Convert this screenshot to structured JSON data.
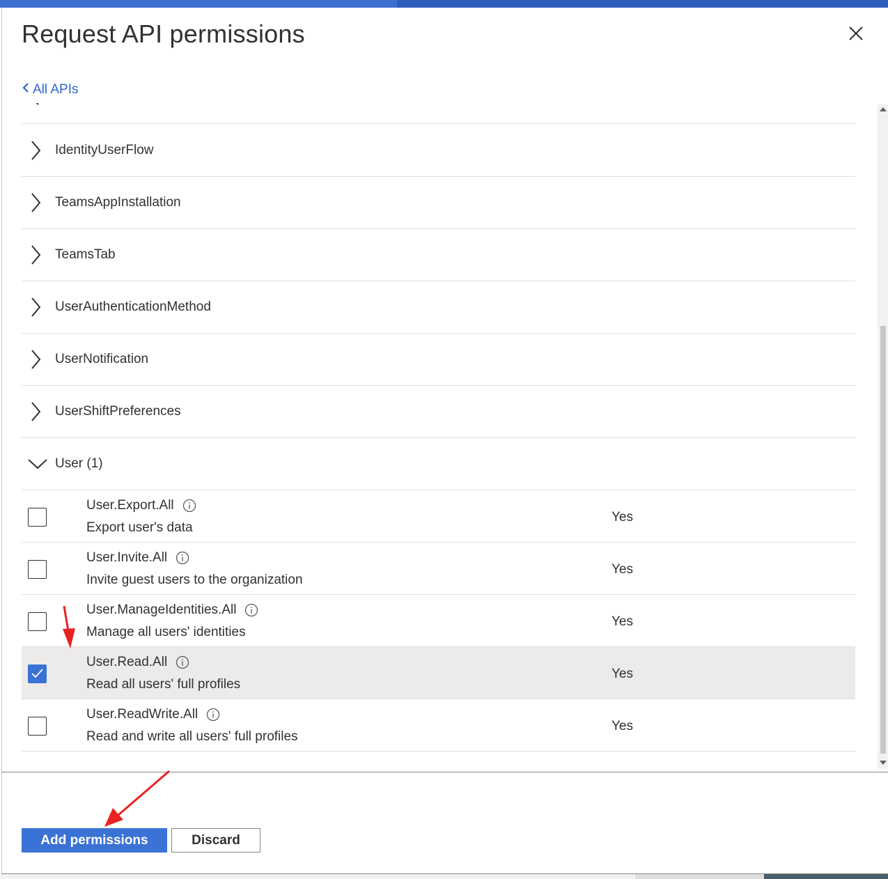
{
  "panel": {
    "title": "Request API permissions",
    "back_link": "All APIs"
  },
  "groups": [
    {
      "label": "IdentityUserFlow",
      "expanded": false
    },
    {
      "label": "TeamsAppInstallation",
      "expanded": false
    },
    {
      "label": "TeamsTab",
      "expanded": false
    },
    {
      "label": "UserAuthenticationMethod",
      "expanded": false
    },
    {
      "label": "UserNotification",
      "expanded": false
    },
    {
      "label": "UserShiftPreferences",
      "expanded": false
    },
    {
      "label": "User (1)",
      "expanded": true
    }
  ],
  "permissions": [
    {
      "name": "User.Export.All",
      "description": "Export user's data",
      "admin_consent": "Yes",
      "checked": false
    },
    {
      "name": "User.Invite.All",
      "description": "Invite guest users to the organization",
      "admin_consent": "Yes",
      "checked": false
    },
    {
      "name": "User.ManageIdentities.All",
      "description": "Manage all users' identities",
      "admin_consent": "Yes",
      "checked": false
    },
    {
      "name": "User.Read.All",
      "description": "Read all users' full profiles",
      "admin_consent": "Yes",
      "checked": true
    },
    {
      "name": "User.ReadWrite.All",
      "description": "Read and write all users' full profiles",
      "admin_consent": "Yes",
      "checked": false
    }
  ],
  "footer": {
    "add_label": "Add permissions",
    "discard_label": "Discard"
  },
  "colors": {
    "accent": "#3a72d6",
    "annotation_arrow": "#e8231f",
    "selected_row": "#edebe9"
  },
  "icons": {
    "close": "close-icon",
    "back": "chevron-left-icon",
    "collapsed": "chevron-right-icon",
    "expanded": "chevron-down-icon",
    "info": "info-icon",
    "check": "checkmark-icon"
  }
}
